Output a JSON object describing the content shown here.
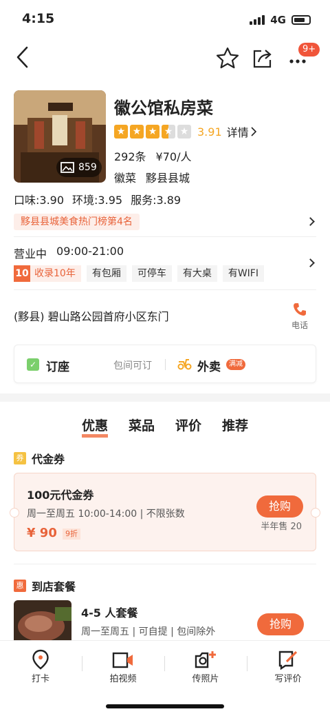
{
  "status": {
    "time": "4:15",
    "network": "4G"
  },
  "nav": {
    "badge": "9+"
  },
  "shop": {
    "name": "徽公馆私房菜",
    "photo_count": "859",
    "rating_value": 3.5,
    "score": "3.91",
    "detail_label": "详情",
    "reviews": "292条",
    "price": "¥70/人",
    "cuisine": "徽菜",
    "area": "黟县县城"
  },
  "sub_scores": {
    "taste": "口味:3.90",
    "environment": "环境:3.95",
    "service": "服务:3.89"
  },
  "rank_tag": "黟县县城美食热门榜第4名",
  "hours": {
    "status": "营业中",
    "time": "09:00-21:00"
  },
  "features": {
    "years_num": "10",
    "years_label": "收录10年",
    "items": [
      "有包厢",
      "可停车",
      "有大桌",
      "有WIFI"
    ]
  },
  "address": "(黟县) 碧山路公园首府小区东门",
  "phone_label": "电话",
  "booking": {
    "label": "订座",
    "sub": "包间可订",
    "waimai_label": "外卖",
    "waimai_badge": "满减"
  },
  "tabs": [
    "优惠",
    "菜品",
    "评价",
    "推荐"
  ],
  "voucher_section": {
    "badge": "券",
    "title": "代金券"
  },
  "voucher": {
    "title": "100元代金券",
    "time": "周一至周五 10:00-14:00 | 不限张数",
    "price": "¥ 90",
    "discount": "9折",
    "button": "抢购",
    "sold": "半年售 20"
  },
  "package_section": {
    "badge": "惠",
    "title": "到店套餐"
  },
  "package": {
    "title": "4-5 人套餐",
    "sub": "周一至周五 | 可自提 | 包间除外",
    "button": "抢购"
  },
  "bottom_bar": [
    {
      "label": "打卡",
      "icon": "location-pin-icon"
    },
    {
      "label": "拍视频",
      "icon": "video-camera-icon"
    },
    {
      "label": "传照片",
      "icon": "photo-upload-icon"
    },
    {
      "label": "写评价",
      "icon": "write-review-icon"
    }
  ],
  "colors": {
    "accent": "#f06a3c",
    "star": "#f5a623"
  }
}
